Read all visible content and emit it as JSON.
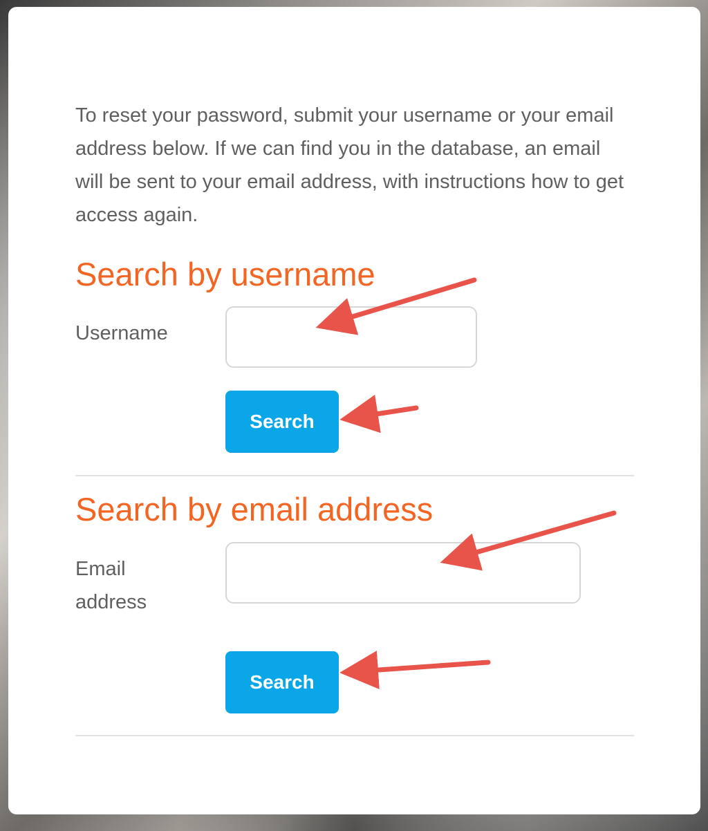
{
  "intro_text": "To reset your password, submit your username or your email address below. If we can find you in the database, an email will be sent to your email address, with instructions how to get access again.",
  "username_section": {
    "heading": "Search by username",
    "label": "Username",
    "input_value": "",
    "button_label": "Search"
  },
  "email_section": {
    "heading": "Search by email address",
    "label": "Email address",
    "input_value": "",
    "button_label": "Search"
  },
  "colors": {
    "heading": "#f26522",
    "button": "#0aa6e8",
    "annotation_arrow": "#e8534a"
  }
}
